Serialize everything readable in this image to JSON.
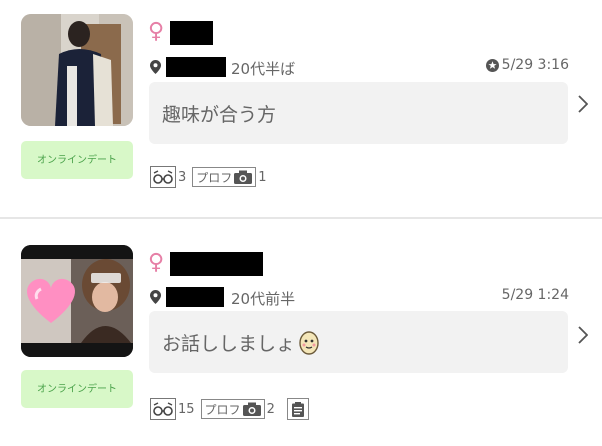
{
  "items": [
    {
      "gender_symbol": "♀",
      "age_label": "20代半ば",
      "time": "5/29 3:16",
      "message": "趣味が合う方",
      "tag": "オンラインデート",
      "footprint_count": "3",
      "prof_label": "プロフ",
      "photo_count": "1"
    },
    {
      "gender_symbol": "♀",
      "age_label": "20代前半",
      "time": "5/29 1:24",
      "message": "お話ししましょ",
      "tag": "オンラインデート",
      "footprint_count": "15",
      "prof_label": "プロフ",
      "photo_count": "2"
    }
  ],
  "colors": {
    "gender": "#e67fa6",
    "tag_bg": "#d8f8c8",
    "tag_text": "#4aa24a",
    "message_bg": "#f2f2f2"
  },
  "icons": [
    "location-pin-icon",
    "star-icon",
    "chevron-right-icon",
    "glasses-icon",
    "camera-icon",
    "memo-icon",
    "emoji-face-icon"
  ]
}
